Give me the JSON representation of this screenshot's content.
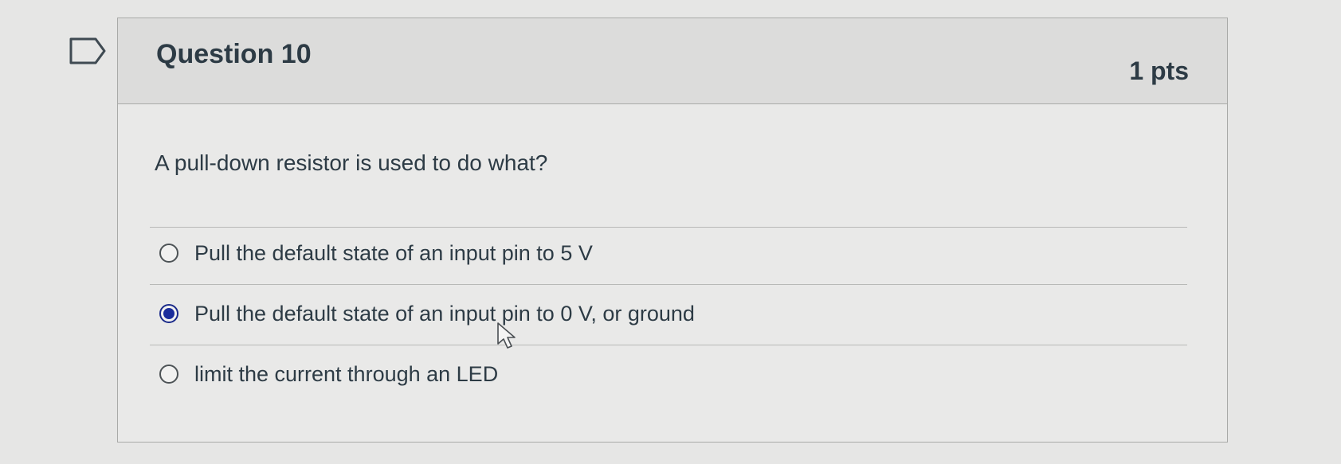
{
  "question": {
    "title": "Question 10",
    "points": "1 pts",
    "prompt": "A pull-down resistor is used to do what?",
    "answers": [
      {
        "label": "Pull the default state of an input pin to 5 V",
        "selected": false
      },
      {
        "label": "Pull the default state of an input pin to 0 V, or ground",
        "selected": true
      },
      {
        "label": "limit the current through an LED",
        "selected": false
      }
    ]
  },
  "icons": {
    "flag": "flag-question-icon",
    "cursor": "mouse-pointer-icon"
  },
  "colors": {
    "selected_radio": "#1b2d9c",
    "text": "#2d3b45",
    "header_bg": "#dcdcdb"
  }
}
